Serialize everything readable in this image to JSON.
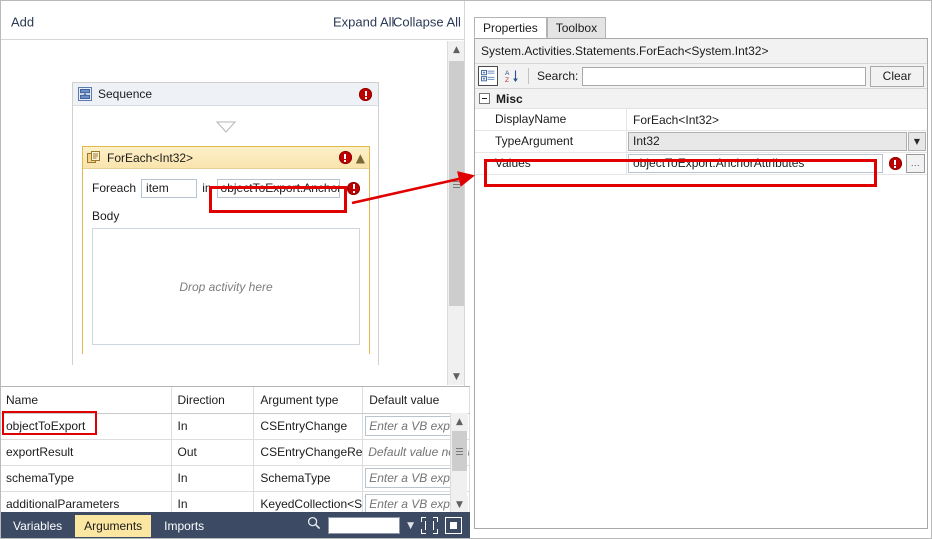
{
  "designer": {
    "commandbar": {
      "add_label": "Add",
      "expand_all_label": "Expand All",
      "collapse_all_label": "Collapse All"
    },
    "sequence": {
      "title": "Sequence",
      "icon": "sequence-icon",
      "error_icon": "error-badge-icon"
    },
    "foreach": {
      "title": "ForEach<Int32>",
      "icon": "foreach-icon",
      "error_icon": "error-badge-icon",
      "collapse_icon": "chevron-up-icon",
      "foreach_label": "Foreach",
      "item_value": "item",
      "in_label": "in",
      "values_expression": "objectToExport.Anchor",
      "values_error_icon": "error-badge-icon",
      "body_label": "Body",
      "drop_zone_text": "Drop activity here"
    },
    "scrollbar": {
      "up_icon": "chevron-up-icon",
      "down_icon": "chevron-down-icon",
      "thumb_icon": "scroll-thumb-grip-icon"
    }
  },
  "arguments_grid": {
    "columns": [
      "Name",
      "Direction",
      "Argument type",
      "Default value"
    ],
    "rows": [
      {
        "name": "objectToExport",
        "direction": "In",
        "type": "CSEntryChange",
        "default_value": "Enter a VB express",
        "default_is_box": true
      },
      {
        "name": "exportResult",
        "direction": "Out",
        "type": "CSEntryChangeRes",
        "default_value": "Default value not su",
        "default_is_box": false
      },
      {
        "name": "schemaType",
        "direction": "In",
        "type": "SchemaType",
        "default_value": "Enter a VB express",
        "default_is_box": true
      },
      {
        "name": "additionalParameters",
        "direction": "In",
        "type": "KeyedCollection<S",
        "default_value": "Enter a VB express",
        "default_is_box": true
      }
    ],
    "scrollbar": {
      "up_icon": "chevron-up-icon",
      "down_icon": "chevron-down-icon",
      "thumb_icon": "scroll-thumb-grip-icon"
    }
  },
  "bottom_bar": {
    "tabs": [
      {
        "label": "Variables",
        "active": false
      },
      {
        "label": "Arguments",
        "active": true
      },
      {
        "label": "Imports",
        "active": false
      }
    ],
    "zoom_search_icon": "magnifier-icon",
    "zoom_value": "",
    "zoom_dropdown_icon": "chevron-down-icon",
    "fit_to_screen_icon": "fit-to-screen-icon",
    "actual_size_icon": "actual-size-icon"
  },
  "properties": {
    "tabs": [
      {
        "label": "Properties",
        "active": true
      },
      {
        "label": "Toolbox",
        "active": false
      }
    ],
    "type_name": "System.Activities.Statements.ForEach<System.Int32>",
    "toolbar": {
      "categorized_icon": "categorized-view-icon",
      "alphabetical_icon": "alphabetical-sort-icon",
      "search_label": "Search:",
      "search_value": "",
      "search_placeholder": "",
      "clear_label": "Clear"
    },
    "category": {
      "label": "Misc",
      "expander_icon": "collapse-box-icon"
    },
    "rows": [
      {
        "name": "DisplayName",
        "value": "ForEach<Int32>",
        "editor": "text",
        "has_dropdown": false,
        "has_error": false,
        "has_ellipsis": false
      },
      {
        "name": "TypeArgument",
        "value": "Int32",
        "editor": "combo",
        "has_dropdown": true,
        "dropdown_icon": "chevron-down-icon",
        "has_error": false,
        "has_ellipsis": false
      },
      {
        "name": "Values",
        "value": "objectToExport.AnchorAttributes",
        "editor": "expression",
        "has_dropdown": false,
        "has_error": true,
        "error_icon": "error-badge-icon",
        "has_ellipsis": true,
        "ellipsis_label": "..."
      }
    ]
  },
  "annotations": {
    "highlight_color": "#e00000",
    "items": [
      {
        "name": "foreach-expression-highlight"
      },
      {
        "name": "values-property-highlight"
      },
      {
        "name": "objecttoexport-argument-highlight"
      },
      {
        "name": "connector-arrow"
      }
    ]
  }
}
